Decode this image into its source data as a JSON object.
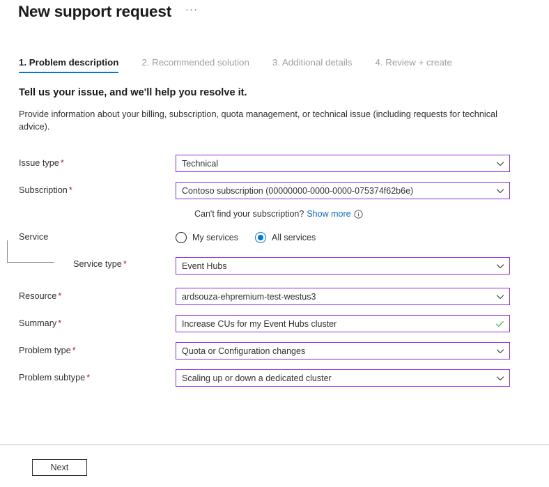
{
  "header": {
    "title": "New support request",
    "more_label": "···"
  },
  "tabs": [
    {
      "label": "1. Problem description",
      "active": true
    },
    {
      "label": "2. Recommended solution",
      "active": false
    },
    {
      "label": "3. Additional details",
      "active": false
    },
    {
      "label": "4. Review + create",
      "active": false
    }
  ],
  "intro": {
    "heading": "Tell us your issue, and we'll help you resolve it.",
    "description": "Provide information about your billing, subscription, quota management, or technical issue (including requests for technical advice)."
  },
  "form": {
    "issue_type": {
      "label": "Issue type",
      "required": "*",
      "value": "Technical"
    },
    "subscription": {
      "label": "Subscription",
      "required": "*",
      "value": "Contoso subscription (00000000-0000-0000-075374f62b6e)"
    },
    "subscription_helper": {
      "text": "Can't find your subscription?",
      "link": "Show more",
      "info_glyph": "ⓘ"
    },
    "service": {
      "label": "Service",
      "radios": [
        {
          "label": "My services",
          "selected": false
        },
        {
          "label": "All services",
          "selected": true
        }
      ]
    },
    "service_type": {
      "label": "Service type",
      "required": "*",
      "value": "Event Hubs"
    },
    "resource": {
      "label": "Resource",
      "required": "*",
      "value": "ardsouza-ehpremium-test-westus3"
    },
    "summary": {
      "label": "Summary",
      "required": "*",
      "value": "Increase CUs for my Event Hubs cluster",
      "valid": true
    },
    "problem_type": {
      "label": "Problem type",
      "required": "*",
      "value": "Quota or Configuration changes"
    },
    "problem_subtype": {
      "label": "Problem subtype",
      "required": "*",
      "value": "Scaling up or down a dedicated cluster"
    }
  },
  "footer": {
    "next_label": "Next"
  },
  "colors": {
    "accent_blue": "#0078d4",
    "field_border_purple": "#8a2be2",
    "required_red": "#a4262c",
    "link_blue": "#0f6cbd",
    "valid_green": "#4caf50",
    "muted_gray": "#a19f9d"
  }
}
